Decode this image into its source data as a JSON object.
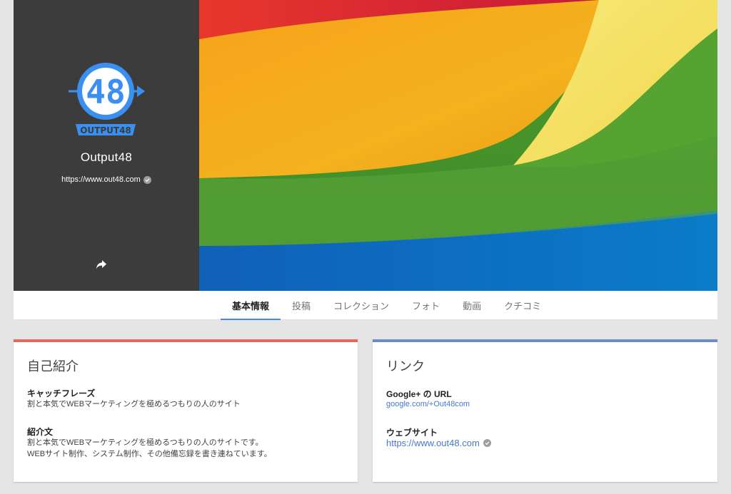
{
  "profile": {
    "name": "Output48",
    "url": "https://www.out48.com",
    "logo": {
      "number": "48",
      "wordmark": "OUTPUT48",
      "color": "#3a8ff0"
    },
    "share_icon": "share-arrow-icon",
    "verified_icon": "verified-check-icon"
  },
  "tabs": [
    {
      "label": "基本情報",
      "active": true
    },
    {
      "label": "投稿",
      "active": false
    },
    {
      "label": "コレクション",
      "active": false
    },
    {
      "label": "フォト",
      "active": false
    },
    {
      "label": "動画",
      "active": false
    },
    {
      "label": "クチコミ",
      "active": false
    }
  ],
  "about": {
    "title": "自己紹介",
    "accent": "#e5685c",
    "catchphrase_label": "キャッチフレーズ",
    "catchphrase_value": "割と本気でWEBマーケティングを極めるつもりの人のサイト",
    "intro_label": "紹介文",
    "intro_line1": "割と本気でWEBマーケティングを極めるつもりの人のサイトです。",
    "intro_line2": "WEBサイト制作、システム制作、その他備忘録を書き連ねています。"
  },
  "links": {
    "title": "リンク",
    "accent": "#6d8bc7",
    "gplus_label": "Google+ の URL",
    "gplus_value": "google.com/+Out48com",
    "website_label": "ウェブサイト",
    "website_value": "https://www.out48.com"
  }
}
